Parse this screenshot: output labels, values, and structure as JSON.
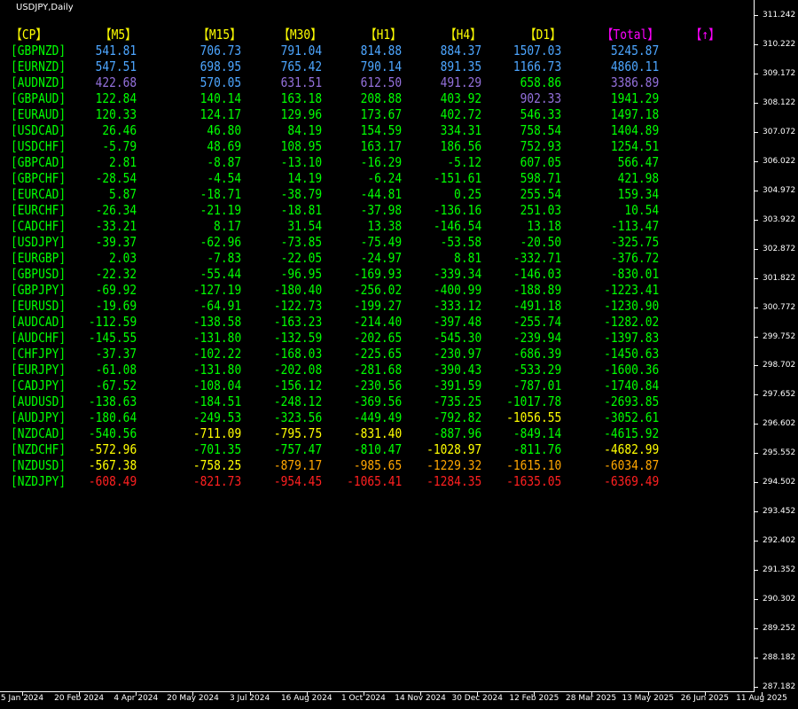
{
  "window": {
    "title": "USDJPY,Daily"
  },
  "colors": {
    "pair": "#00ff00",
    "header": "#ffff00",
    "header_total": "#ff00ff",
    "blue": "#4da6ff",
    "purple": "#9370db",
    "green": "#00ff00",
    "yellow": "#ffff00",
    "orange": "#ffa500",
    "red": "#ff2020",
    "axis": "#ffffff"
  },
  "table": {
    "headers": {
      "pair": "【CP】",
      "m5": "【M5】",
      "m15": "【M15】",
      "m30": "【M30】",
      "h1": "【H1】",
      "h4": "【H4】",
      "d1": "【D1】",
      "total": "【Total】",
      "sort": "【↑】"
    },
    "rows": [
      {
        "pair": "[GBPNZD]",
        "values": [
          "541.81",
          "706.73",
          "791.04",
          "814.88",
          "884.37",
          "1507.03",
          "5245.87"
        ],
        "colors": [
          "blue",
          "blue",
          "blue",
          "blue",
          "blue",
          "blue",
          "blue"
        ]
      },
      {
        "pair": "[EURNZD]",
        "values": [
          "547.51",
          "698.95",
          "765.42",
          "790.14",
          "891.35",
          "1166.73",
          "4860.11"
        ],
        "colors": [
          "blue",
          "blue",
          "blue",
          "blue",
          "blue",
          "blue",
          "blue"
        ]
      },
      {
        "pair": "[AUDNZD]",
        "values": [
          "422.68",
          "570.05",
          "631.51",
          "612.50",
          "491.29",
          "658.86",
          "3386.89"
        ],
        "colors": [
          "purple",
          "blue",
          "purple",
          "purple",
          "purple",
          "green",
          "purple"
        ]
      },
      {
        "pair": "[GBPAUD]",
        "values": [
          "122.84",
          "140.14",
          "163.18",
          "208.88",
          "403.92",
          "902.33",
          "1941.29"
        ],
        "colors": [
          "green",
          "green",
          "green",
          "green",
          "green",
          "purple",
          "green"
        ]
      },
      {
        "pair": "[EURAUD]",
        "values": [
          "120.33",
          "124.17",
          "129.96",
          "173.67",
          "402.72",
          "546.33",
          "1497.18"
        ],
        "colors": [
          "green",
          "green",
          "green",
          "green",
          "green",
          "green",
          "green"
        ]
      },
      {
        "pair": "[USDCAD]",
        "values": [
          "26.46",
          "46.80",
          "84.19",
          "154.59",
          "334.31",
          "758.54",
          "1404.89"
        ],
        "colors": [
          "green",
          "green",
          "green",
          "green",
          "green",
          "green",
          "green"
        ]
      },
      {
        "pair": "[USDCHF]",
        "values": [
          "-5.79",
          "48.69",
          "108.95",
          "163.17",
          "186.56",
          "752.93",
          "1254.51"
        ],
        "colors": [
          "green",
          "green",
          "green",
          "green",
          "green",
          "green",
          "green"
        ]
      },
      {
        "pair": "[GBPCAD]",
        "values": [
          "2.81",
          "-8.87",
          "-13.10",
          "-16.29",
          "-5.12",
          "607.05",
          "566.47"
        ],
        "colors": [
          "green",
          "green",
          "green",
          "green",
          "green",
          "green",
          "green"
        ]
      },
      {
        "pair": "[GBPCHF]",
        "values": [
          "-28.54",
          "-4.54",
          "14.19",
          "-6.24",
          "-151.61",
          "598.71",
          "421.98"
        ],
        "colors": [
          "green",
          "green",
          "green",
          "green",
          "green",
          "green",
          "green"
        ]
      },
      {
        "pair": "[EURCAD]",
        "values": [
          "5.87",
          "-18.71",
          "-38.79",
          "-44.81",
          "0.25",
          "255.54",
          "159.34"
        ],
        "colors": [
          "green",
          "green",
          "green",
          "green",
          "green",
          "green",
          "green"
        ]
      },
      {
        "pair": "[EURCHF]",
        "values": [
          "-26.34",
          "-21.19",
          "-18.81",
          "-37.98",
          "-136.16",
          "251.03",
          "10.54"
        ],
        "colors": [
          "green",
          "green",
          "green",
          "green",
          "green",
          "green",
          "green"
        ]
      },
      {
        "pair": "[CADCHF]",
        "values": [
          "-33.21",
          "8.17",
          "31.54",
          "13.38",
          "-146.54",
          "13.18",
          "-113.47"
        ],
        "colors": [
          "green",
          "green",
          "green",
          "green",
          "green",
          "green",
          "green"
        ]
      },
      {
        "pair": "[USDJPY]",
        "values": [
          "-39.37",
          "-62.96",
          "-73.85",
          "-75.49",
          "-53.58",
          "-20.50",
          "-325.75"
        ],
        "colors": [
          "green",
          "green",
          "green",
          "green",
          "green",
          "green",
          "green"
        ]
      },
      {
        "pair": "[EURGBP]",
        "values": [
          "2.03",
          "-7.83",
          "-22.05",
          "-24.97",
          "8.81",
          "-332.71",
          "-376.72"
        ],
        "colors": [
          "green",
          "green",
          "green",
          "green",
          "green",
          "green",
          "green"
        ]
      },
      {
        "pair": "[GBPUSD]",
        "values": [
          "-22.32",
          "-55.44",
          "-96.95",
          "-169.93",
          "-339.34",
          "-146.03",
          "-830.01"
        ],
        "colors": [
          "green",
          "green",
          "green",
          "green",
          "green",
          "green",
          "green"
        ]
      },
      {
        "pair": "[GBPJPY]",
        "values": [
          "-69.92",
          "-127.19",
          "-180.40",
          "-256.02",
          "-400.99",
          "-188.89",
          "-1223.41"
        ],
        "colors": [
          "green",
          "green",
          "green",
          "green",
          "green",
          "green",
          "green"
        ]
      },
      {
        "pair": "[EURUSD]",
        "values": [
          "-19.69",
          "-64.91",
          "-122.73",
          "-199.27",
          "-333.12",
          "-491.18",
          "-1230.90"
        ],
        "colors": [
          "green",
          "green",
          "green",
          "green",
          "green",
          "green",
          "green"
        ]
      },
      {
        "pair": "[AUDCAD]",
        "values": [
          "-112.59",
          "-138.58",
          "-163.23",
          "-214.40",
          "-397.48",
          "-255.74",
          "-1282.02"
        ],
        "colors": [
          "green",
          "green",
          "green",
          "green",
          "green",
          "green",
          "green"
        ]
      },
      {
        "pair": "[AUDCHF]",
        "values": [
          "-145.55",
          "-131.80",
          "-132.59",
          "-202.65",
          "-545.30",
          "-239.94",
          "-1397.83"
        ],
        "colors": [
          "green",
          "green",
          "green",
          "green",
          "green",
          "green",
          "green"
        ]
      },
      {
        "pair": "[CHFJPY]",
        "values": [
          "-37.37",
          "-102.22",
          "-168.03",
          "-225.65",
          "-230.97",
          "-686.39",
          "-1450.63"
        ],
        "colors": [
          "green",
          "green",
          "green",
          "green",
          "green",
          "green",
          "green"
        ]
      },
      {
        "pair": "[EURJPY]",
        "values": [
          "-61.08",
          "-131.80",
          "-202.08",
          "-281.68",
          "-390.43",
          "-533.29",
          "-1600.36"
        ],
        "colors": [
          "green",
          "green",
          "green",
          "green",
          "green",
          "green",
          "green"
        ]
      },
      {
        "pair": "[CADJPY]",
        "values": [
          "-67.52",
          "-108.04",
          "-156.12",
          "-230.56",
          "-391.59",
          "-787.01",
          "-1740.84"
        ],
        "colors": [
          "green",
          "green",
          "green",
          "green",
          "green",
          "green",
          "green"
        ]
      },
      {
        "pair": "[AUDUSD]",
        "values": [
          "-138.63",
          "-184.51",
          "-248.12",
          "-369.56",
          "-735.25",
          "-1017.78",
          "-2693.85"
        ],
        "colors": [
          "green",
          "green",
          "green",
          "green",
          "green",
          "green",
          "green"
        ]
      },
      {
        "pair": "[AUDJPY]",
        "values": [
          "-180.64",
          "-249.53",
          "-323.56",
          "-449.49",
          "-792.82",
          "-1056.55",
          "-3052.61"
        ],
        "colors": [
          "green",
          "green",
          "green",
          "green",
          "green",
          "yellow",
          "green"
        ]
      },
      {
        "pair": "[NZDCAD]",
        "values": [
          "-540.56",
          "-711.09",
          "-795.75",
          "-831.40",
          "-887.96",
          "-849.14",
          "-4615.92"
        ],
        "colors": [
          "green",
          "yellow",
          "yellow",
          "yellow",
          "green",
          "green",
          "green"
        ]
      },
      {
        "pair": "[NZDCHF]",
        "values": [
          "-572.96",
          "-701.35",
          "-757.47",
          "-810.47",
          "-1028.97",
          "-811.76",
          "-4682.99"
        ],
        "colors": [
          "yellow",
          "green",
          "green",
          "green",
          "yellow",
          "green",
          "yellow"
        ]
      },
      {
        "pair": "[NZDUSD]",
        "values": [
          "-567.38",
          "-758.25",
          "-879.17",
          "-985.65",
          "-1229.32",
          "-1615.10",
          "-6034.87"
        ],
        "colors": [
          "yellow",
          "yellow",
          "orange",
          "orange",
          "orange",
          "orange",
          "orange"
        ]
      },
      {
        "pair": "[NZDJPY]",
        "values": [
          "-608.49",
          "-821.73",
          "-954.45",
          "-1065.41",
          "-1284.35",
          "-1635.05",
          "-6369.49"
        ],
        "colors": [
          "red",
          "red",
          "red",
          "red",
          "red",
          "red",
          "red"
        ]
      }
    ]
  },
  "y_axis": {
    "labels": [
      "311.242",
      "310.222",
      "309.172",
      "308.122",
      "307.072",
      "306.022",
      "304.972",
      "303.922",
      "302.872",
      "301.822",
      "300.772",
      "299.752",
      "298.702",
      "297.652",
      "296.602",
      "295.552",
      "294.502",
      "293.452",
      "292.402",
      "291.352",
      "290.302",
      "289.252",
      "288.182",
      "287.182"
    ]
  },
  "x_axis": {
    "labels": [
      "5 Jan 2024",
      "20 Feb 2024",
      "4 Apr 2024",
      "20 May 2024",
      "3 Jul 2024",
      "16 Aug 2024",
      "1 Oct 2024",
      "14 Nov 2024",
      "30 Dec 2024",
      "12 Feb 2025",
      "28 Mar 2025",
      "13 May 2025",
      "26 Jun 2025",
      "11 Aug 2025"
    ]
  }
}
